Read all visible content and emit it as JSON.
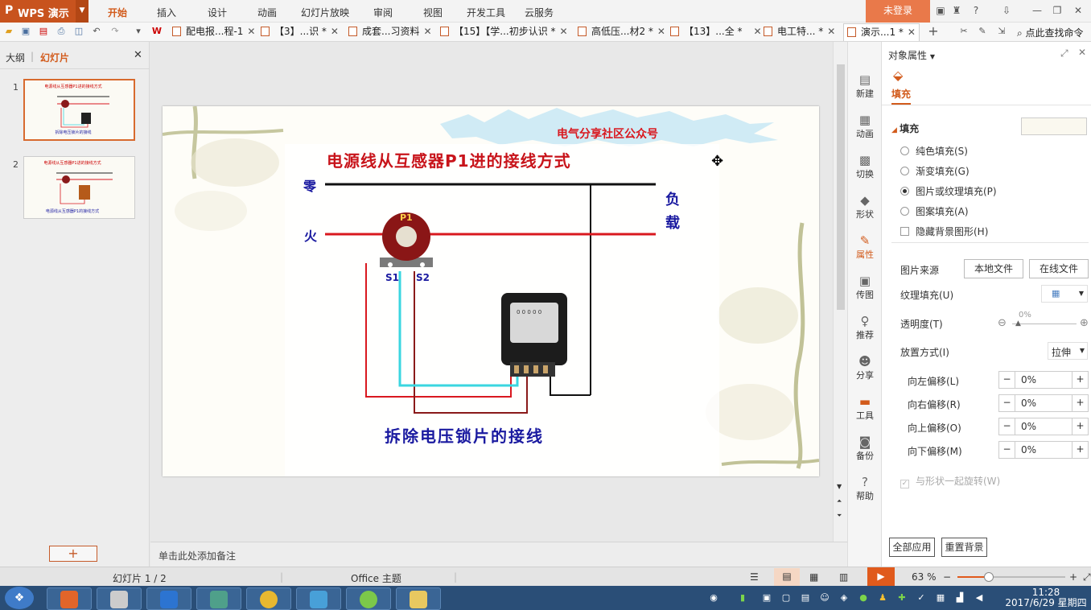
{
  "titlebar": {
    "app_name": "WPS 演示",
    "menus": [
      "开始",
      "插入",
      "设计",
      "动画",
      "幻灯片放映",
      "审阅",
      "视图",
      "开发工具",
      "云服务"
    ],
    "active_menu": "开始",
    "login": "未登录"
  },
  "tabs": [
    {
      "label": "配电报...程-1"
    },
    {
      "label": "【3】...识 *"
    },
    {
      "label": "成套...习资料"
    },
    {
      "label": "【15】【学...初步认识 *"
    },
    {
      "label": "高低压...材2 *"
    },
    {
      "label": "【13】...全 *"
    },
    {
      "label": "电工特... *"
    },
    {
      "label": "演示...1 *"
    }
  ],
  "search_label": "点此查找命令",
  "left_panel": {
    "tab_outline": "大纲",
    "tab_slides": "幻灯片",
    "slides": [
      {
        "num": "1",
        "title": "电源线从互感器P1进的接线方式",
        "bottom": "拆除电压锁片的接线"
      },
      {
        "num": "2",
        "title": "电源线从互感器P1进的接线方式",
        "bottom": "电源线从互感器P1的接线方式"
      }
    ]
  },
  "slide": {
    "banner": "电气分享社区公众号",
    "title": "电源线从互感器P1进的接线方式",
    "label_zero": "零",
    "label_fire": "火",
    "label_load": "负载",
    "label_p1": "P1",
    "label_s1": "S1",
    "label_s2": "S2",
    "caption": "拆除电压锁片的接线",
    "meter_dial": "0 0 0 0 0"
  },
  "notes_placeholder": "单击此处添加备注",
  "side_icons": [
    {
      "name": "new",
      "label": "新建",
      "glyph": "▤"
    },
    {
      "name": "animation",
      "label": "动画",
      "glyph": "▦"
    },
    {
      "name": "transition",
      "label": "切换",
      "glyph": "▩"
    },
    {
      "name": "shape",
      "label": "形状",
      "glyph": "◆"
    },
    {
      "name": "properties",
      "label": "属性",
      "glyph": "✎"
    },
    {
      "name": "image",
      "label": "传图",
      "glyph": "▣"
    },
    {
      "name": "recommend",
      "label": "推荐",
      "glyph": "♀"
    },
    {
      "name": "share",
      "label": "分享",
      "glyph": "☻"
    },
    {
      "name": "tools",
      "label": "工具",
      "glyph": "▬"
    },
    {
      "name": "backup",
      "label": "备份",
      "glyph": "◙"
    },
    {
      "name": "help",
      "label": "帮助",
      "glyph": "?"
    }
  ],
  "properties": {
    "title": "对象属性",
    "fill_tab": "填充",
    "section": "填充",
    "options": [
      "纯色填充(S)",
      "渐变填充(G)",
      "图片或纹理填充(P)",
      "图案填充(A)"
    ],
    "selected_option": 2,
    "hide_bg": "隐藏背景图形(H)",
    "pic_source": "图片来源",
    "local_file": "本地文件",
    "online_file": "在线文件",
    "texture_fill": "纹理填充(U)",
    "transparency": "透明度(T)",
    "transparency_value": "0%",
    "placement": "放置方式(I)",
    "placement_value": "拉伸",
    "offsets": [
      {
        "label": "向左偏移(L)",
        "value": "0%"
      },
      {
        "label": "向右偏移(R)",
        "value": "0%"
      },
      {
        "label": "向上偏移(O)",
        "value": "0%"
      },
      {
        "label": "向下偏移(M)",
        "value": "0%"
      }
    ],
    "rotate_with_shape": "与形状一起旋转(W)",
    "apply_all": "全部应用",
    "reset_bg": "重置背景"
  },
  "status": {
    "slide_counter": "幻灯片 1 / 2",
    "theme": "Office 主题",
    "zoom": "63 %"
  },
  "clock": {
    "time": "11:28",
    "date": "2017/6/29 星期四"
  },
  "colors": {
    "brand": "#c8531e",
    "accent": "#d25b1c",
    "wire_red": "#d9181f",
    "wire_cyan": "#3ad6e0",
    "title_red": "#c8141b",
    "caption_blue": "#1a1aa0"
  }
}
